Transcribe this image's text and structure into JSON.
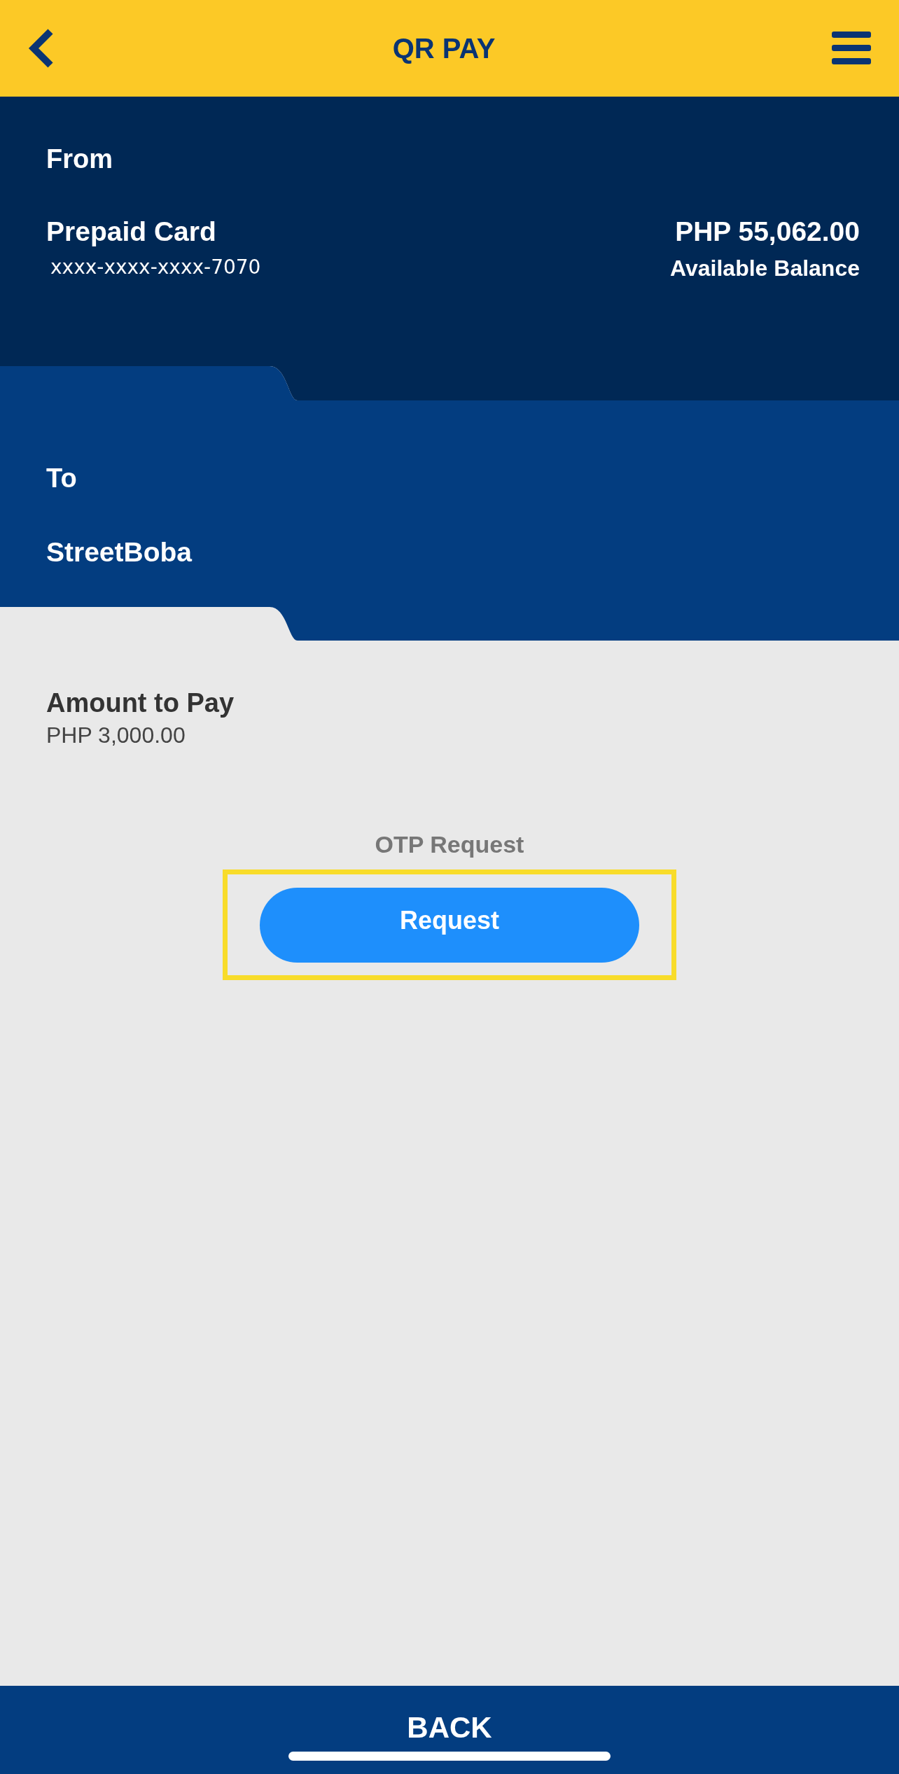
{
  "header": {
    "title": "QR PAY"
  },
  "from": {
    "label": "From",
    "account_name": "Prepaid Card",
    "account_number": "xxxx-xxxx-xxxx-7070",
    "balance": "PHP 55,062.00",
    "balance_label": "Available Balance"
  },
  "to": {
    "label": "To",
    "merchant": "StreetBoba"
  },
  "amount": {
    "label": "Amount to Pay",
    "value": "PHP 3,000.00"
  },
  "otp": {
    "label": "OTP Request",
    "button": "Request"
  },
  "footer": {
    "button": "BACK"
  }
}
